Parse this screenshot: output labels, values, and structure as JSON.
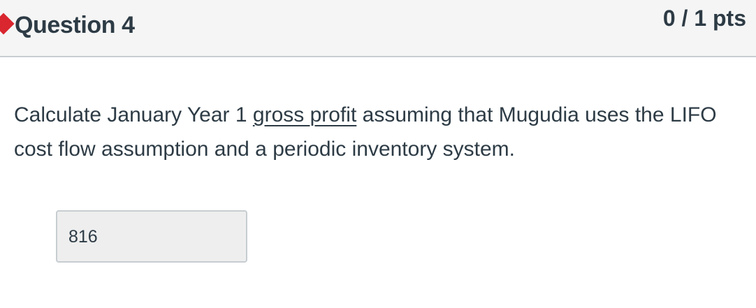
{
  "question": {
    "title": "Question 4",
    "points": "0 / 1 pts",
    "status_color": "#d9262f",
    "status_marker": "incorrect-marker",
    "text": {
      "before_link": "Calculate January Year 1 ",
      "link": "gross profit",
      "after_link": " assuming that Mugudia uses the LIFO cost flow assumption and a periodic inventory system."
    },
    "answer": "816"
  }
}
